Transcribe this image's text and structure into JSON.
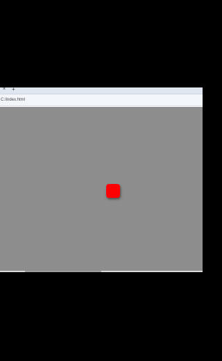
{
  "browser": {
    "tab": {
      "close_glyph": "×",
      "new_tab_glyph": "+"
    },
    "address_bar": {
      "url": "C:/index.html"
    }
  },
  "canvas": {
    "background_color": "#8d8d8d",
    "square_color": "#ff0000"
  }
}
